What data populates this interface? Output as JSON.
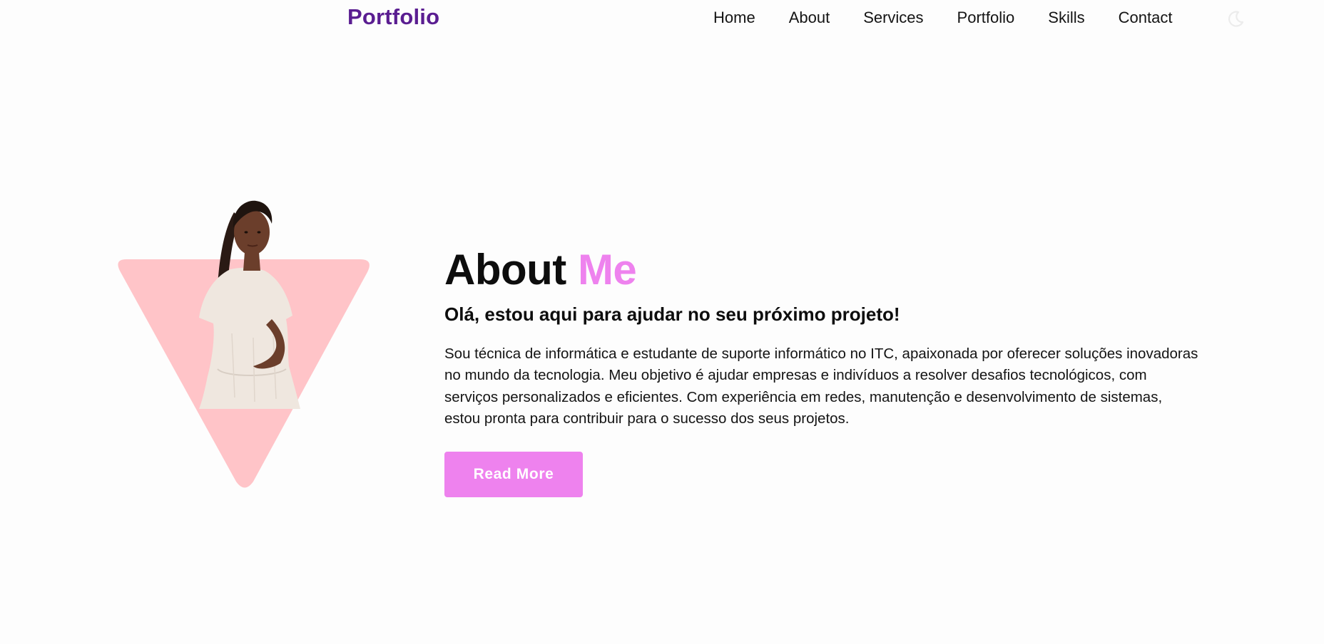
{
  "header": {
    "logo": "Portfolio",
    "nav": [
      "Home",
      "About",
      "Services",
      "Portfolio",
      "Skills",
      "Contact"
    ],
    "theme_toggle_icon": "moon-icon"
  },
  "about": {
    "title_main": "About",
    "title_accent": "Me",
    "subtitle": "Olá, estou aqui para ajudar no seu próximo projeto!",
    "body": "Sou técnica de informática e estudante de suporte informático no ITC, apaixonada por oferecer soluções inovadoras no mundo da tecnologia. Meu objetivo é ajudar empresas e indivíduos a resolver desafios tecnológicos, com serviços personalizados e eficientes. Com experiência em redes, manutenção e desenvolvimento de sistemas, estou pronta para contribuir para o sucesso dos seus projetos.",
    "button": "Read More"
  },
  "colors": {
    "brand": "#5a1d91",
    "accent": "#ee82ee",
    "triangle": "#ffc4c8",
    "background": "#fdfdfd"
  }
}
